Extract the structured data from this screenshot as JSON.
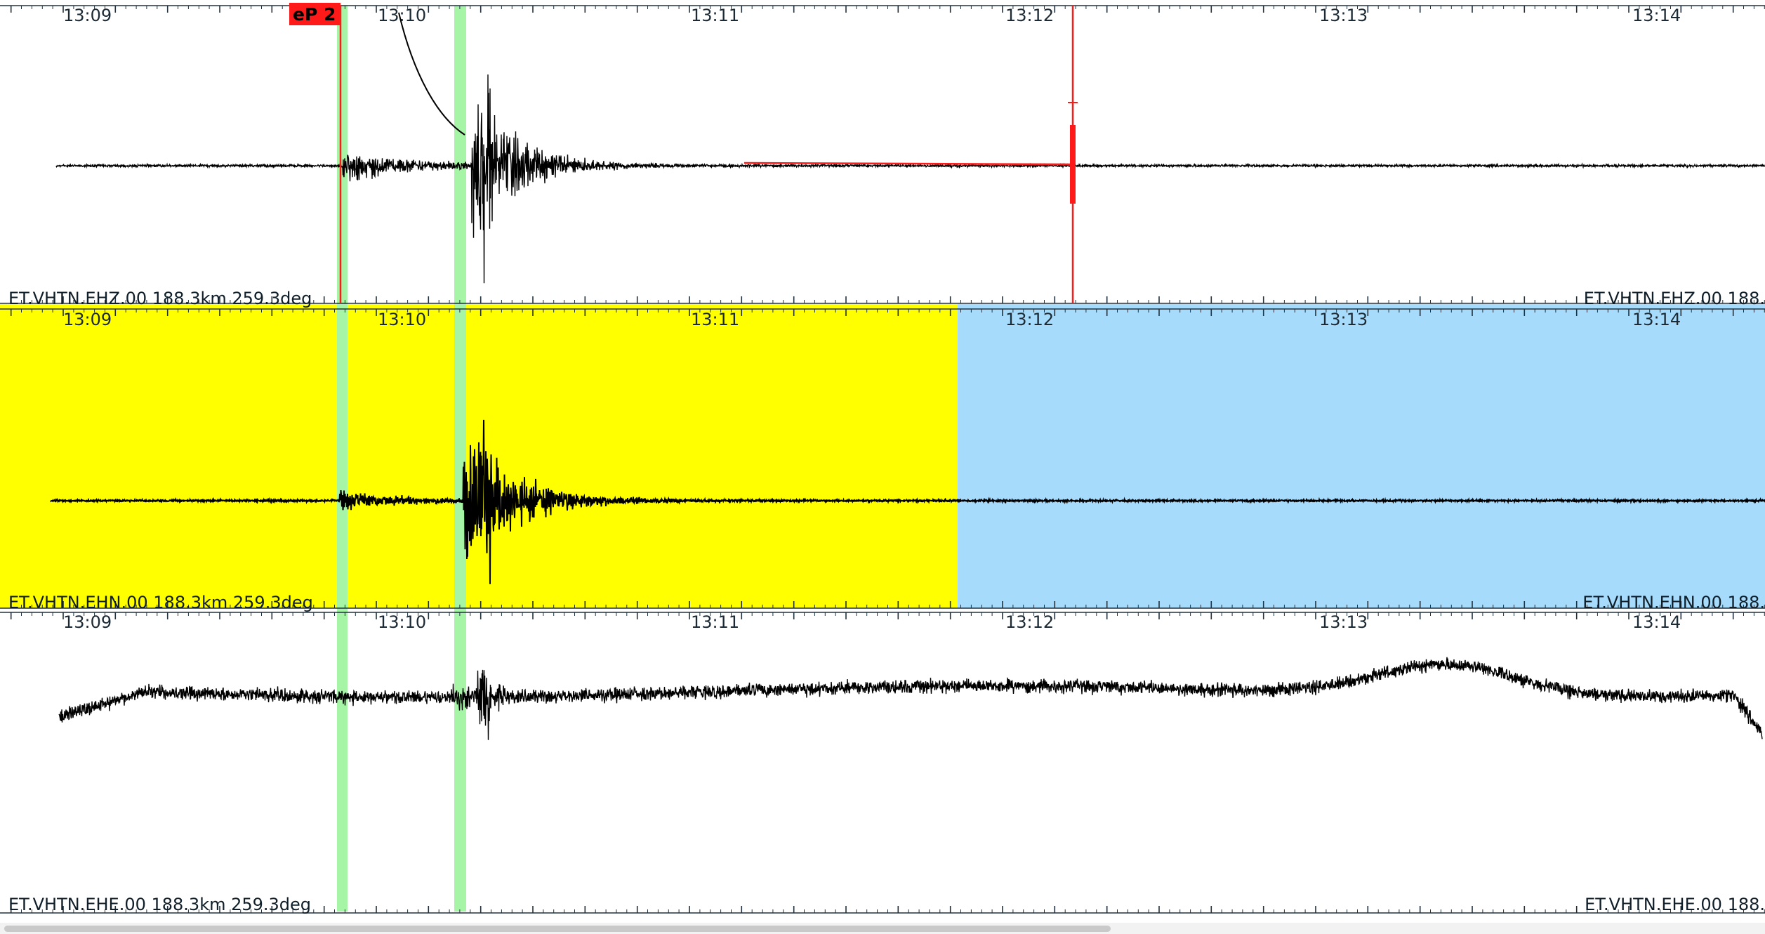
{
  "panels": [
    {
      "id": "ehz",
      "label_left": "ET.VHTN.EHZ.00 188.3km 259.3deg",
      "label_right": "ET.VHTN.EHZ.00 188.",
      "time_ticks": [
        "13:09",
        "13:10",
        "13:11",
        "13:12",
        "13:13",
        "13:14"
      ],
      "pick_label": "eP 2"
    },
    {
      "id": "ehn",
      "label_left": "ET.VHTN.EHN.00 188.3km 259.3deg",
      "label_right": "ET.VHTN.EHN.00 188.",
      "time_ticks": [
        "13:09",
        "13:10",
        "13:11",
        "13:12",
        "13:13",
        "13:14"
      ]
    },
    {
      "id": "ehe",
      "label_left": "ET.VHTN.EHE.00 188.3km 259.3deg",
      "label_right": "ET.VHTN.EHE.00 188.",
      "time_ticks": [
        "13:09",
        "13:10",
        "13:11",
        "13:12",
        "13:13",
        "13:14"
      ]
    }
  ],
  "colors": {
    "pick_marker": "#ff1a1a",
    "phase_window": "#a6f5a6",
    "signal_window": "#ffff00",
    "noise_window": "#a7dbfc",
    "trace": "#000000"
  },
  "scrollbar": {
    "position_fraction": 0.0,
    "visible_fraction": 0.63
  }
}
